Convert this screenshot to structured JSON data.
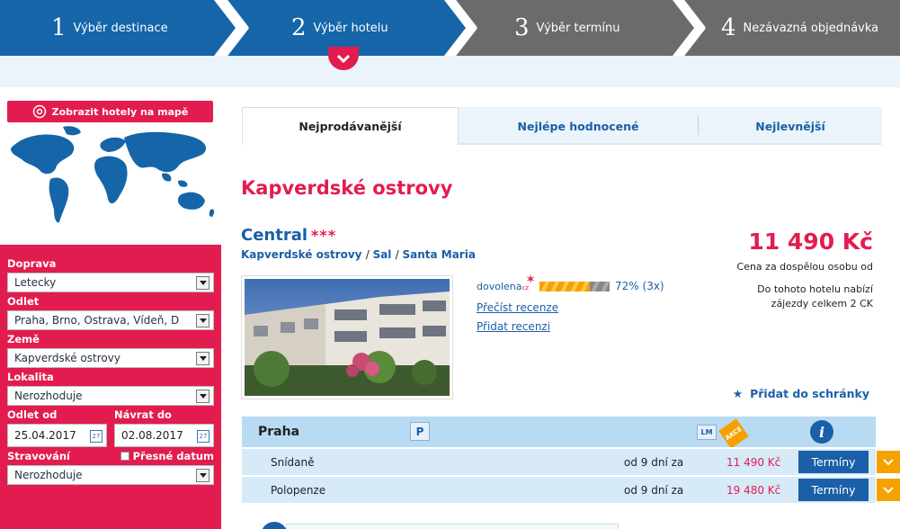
{
  "steps": [
    {
      "num": "1",
      "label": "Výběr destinace",
      "color": "#1565a8"
    },
    {
      "num": "2",
      "label": "Výběr hotelu",
      "color": "#1565a8"
    },
    {
      "num": "3",
      "label": "Výběr termínu",
      "color": "#6b6b6b"
    },
    {
      "num": "4",
      "label": "Nezávazná objednávka",
      "color": "#6b6b6b"
    }
  ],
  "sidebar": {
    "map_button": "Zobrazit hotely na mapě",
    "filters": {
      "doprava_label": "Doprava",
      "doprava_value": "Letecky",
      "odlet_label": "Odlet",
      "odlet_value": "Praha, Brno, Ostrava, Vídeň, D",
      "zeme_label": "Země",
      "zeme_value": "Kapverdské ostrovy",
      "lokalita_label": "Lokalita",
      "lokalita_value": "Nerozhoduje",
      "odlet_od_label": "Odlet od",
      "odlet_od_value": "25.04.2017",
      "navrat_label": "Návrat do",
      "navrat_value": "02.08.2017",
      "stravovani_label": "Stravování",
      "presne_datum_label": "Přesné datum",
      "stravovani_value": "Nerozhoduje"
    }
  },
  "tabs": [
    "Nejprodávanější",
    "Nejlépe hodnocené",
    "Nejlevnější"
  ],
  "destination_title": "Kapverdské ostrovy",
  "hotel": {
    "name": "Central",
    "stars": "***",
    "loc_country": "Kapverdské ostrovy",
    "loc_island": "Sal",
    "loc_town": "Santa Maria",
    "rating_brand": "dovolena",
    "rating_brand_tld": "cz",
    "rating_percent": 72,
    "rating_text": "72% (3x)",
    "read_reviews": "Přečíst recenze",
    "add_review": "Přidat recenzi",
    "price": "11 490 Kč",
    "price_note": "Cena za dospělou osobu od",
    "ck_note": "Do tohoto hotelu nabízí zájezdy celkem 2 CK",
    "clipboard": "Přidat do schránky"
  },
  "offer_table": {
    "city": "Praha",
    "parking_badge": "P",
    "lm_badge": "LM",
    "akce_badge": "AKCE",
    "info_icon": "i",
    "rows": [
      {
        "board": "Snídaně",
        "days": "od 9 dní za",
        "price": "11 490 Kč",
        "button": "Termíny"
      },
      {
        "board": "Polopenze",
        "days": "od 9 dní za",
        "price": "19 480 Kč",
        "button": "Termíny"
      }
    ]
  }
}
